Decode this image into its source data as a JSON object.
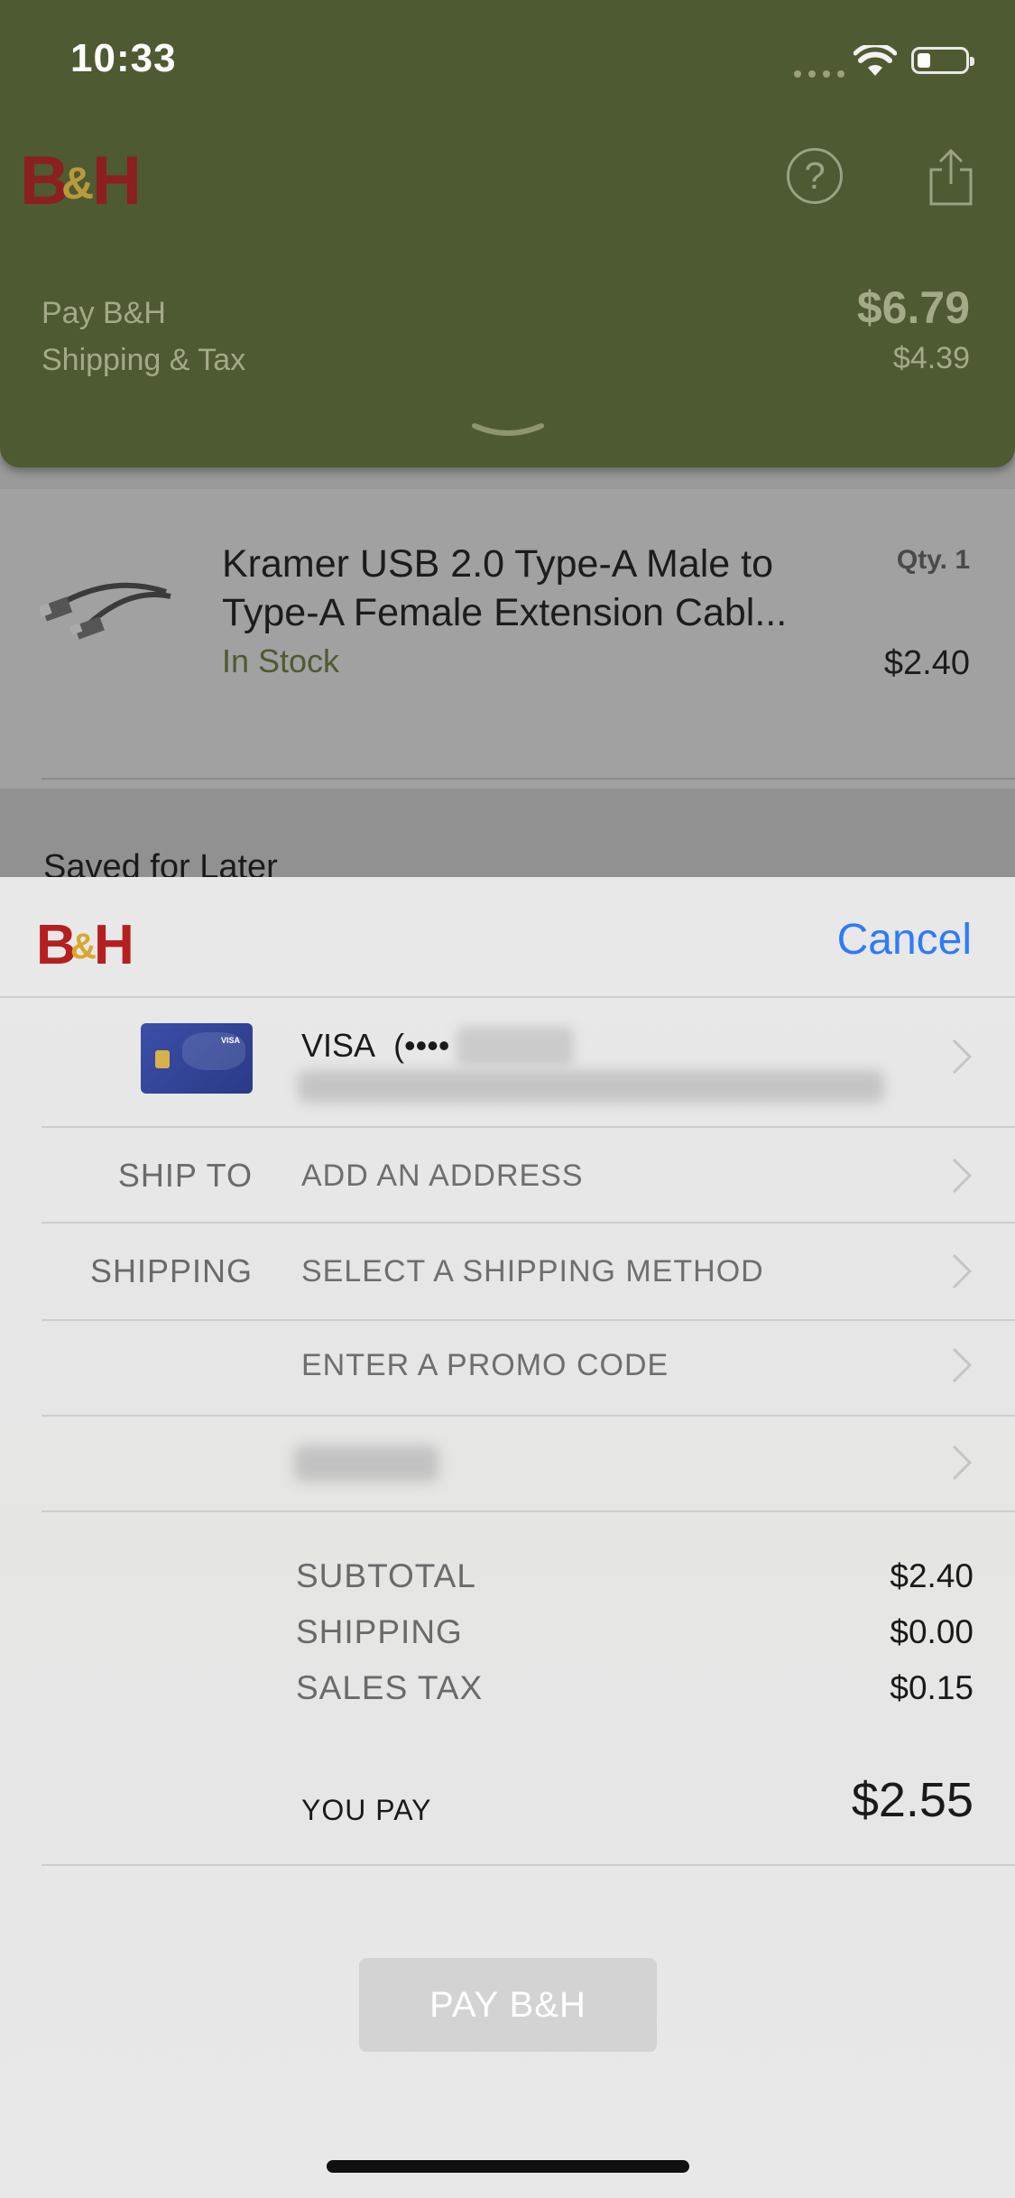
{
  "status_bar": {
    "time": "10:33"
  },
  "header": {
    "pay_label": "Pay B&H",
    "pay_amount": "$6.79",
    "shipping_tax_label": "Shipping & Tax",
    "shipping_tax_amount": "$4.39",
    "brand_color": "#4e5a31"
  },
  "cart": {
    "item": {
      "name": "Kramer USB 2.0 Type-A Male to Type-A Female Extension Cabl...",
      "stock": "In Stock",
      "qty": "Qty. 1",
      "price": "$2.40"
    },
    "saved_for_later": "Saved for Later"
  },
  "sheet": {
    "cancel_label": "Cancel",
    "card": {
      "brand": "VISA",
      "masked": "(••••",
      "icon_text": "VISA"
    },
    "ship_to": {
      "key": "SHIP TO",
      "value": "ADD AN ADDRESS"
    },
    "shipping": {
      "key": "SHIPPING",
      "value": "SELECT A SHIPPING METHOD"
    },
    "promo": {
      "value": "ENTER A PROMO CODE"
    },
    "totals": {
      "subtotal_label": "SUBTOTAL",
      "subtotal": "$2.40",
      "shipping_label": "SHIPPING",
      "shipping": "$0.00",
      "tax_label": "SALES TAX",
      "tax": "$0.15"
    },
    "you_pay_label": "YOU PAY",
    "you_pay": "$2.55",
    "pay_button": "PAY B&H",
    "accent_color": "#2f7bf5"
  }
}
